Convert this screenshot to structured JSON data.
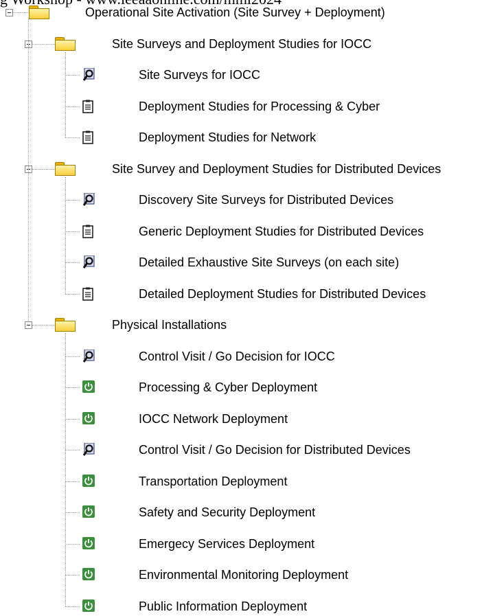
{
  "overlay_text": "g Workshop - www.ieeaaonline.com/mmi2024",
  "tree": {
    "root": {
      "label": "Operational Site Activation (Site Survey + Deployment)",
      "icon": "folder-icon",
      "expanded": true
    },
    "groups": [
      {
        "label": "Site Surveys and Deployment Studies for IOCC",
        "icon": "folder-icon",
        "expanded": true,
        "items": [
          {
            "label": "Site Surveys for IOCC",
            "icon": "site-survey-icon"
          },
          {
            "label": "Deployment Studies for Processing & Cyber",
            "icon": "clipboard-icon"
          },
          {
            "label": "Deployment Studies for Network",
            "icon": "clipboard-icon"
          }
        ]
      },
      {
        "label": "Site Survey and Deployment Studies for Distributed Devices",
        "icon": "folder-icon",
        "expanded": true,
        "items": [
          {
            "label": "Discovery Site Surveys for Distributed Devices",
            "icon": "site-survey-icon"
          },
          {
            "label": "Generic Deployment Studies for Distributed Devices",
            "icon": "clipboard-icon"
          },
          {
            "label": "Detailed Exhaustive Site Surveys (on each site)",
            "icon": "site-survey-icon"
          },
          {
            "label": "Detailed Deployment Studies for Distributed Devices",
            "icon": "clipboard-icon"
          }
        ]
      },
      {
        "label": "Physical Installations",
        "icon": "folder-icon",
        "expanded": true,
        "items": [
          {
            "label": "Control Visit / Go Decision for IOCC",
            "icon": "site-survey-icon"
          },
          {
            "label": "Processing & Cyber Deployment",
            "icon": "power-icon"
          },
          {
            "label": "IOCC Network Deployment",
            "icon": "power-icon"
          },
          {
            "label": "Control Visit / Go Decision for Distributed Devices",
            "icon": "site-survey-icon"
          },
          {
            "label": "Transportation Deployment",
            "icon": "power-icon"
          },
          {
            "label": "Safety and Security Deployment",
            "icon": "power-icon"
          },
          {
            "label": "Emergecy Services Deployment",
            "icon": "power-icon"
          },
          {
            "label": "Environmental Monitoring Deployment",
            "icon": "power-icon"
          },
          {
            "label": "Public Information Deployment",
            "icon": "power-icon"
          }
        ]
      }
    ]
  },
  "colors": {
    "folder": "#f6cf3a",
    "power": "#3c8f3c",
    "survey": "#1c2f78",
    "connector": "#9a9a9a"
  }
}
